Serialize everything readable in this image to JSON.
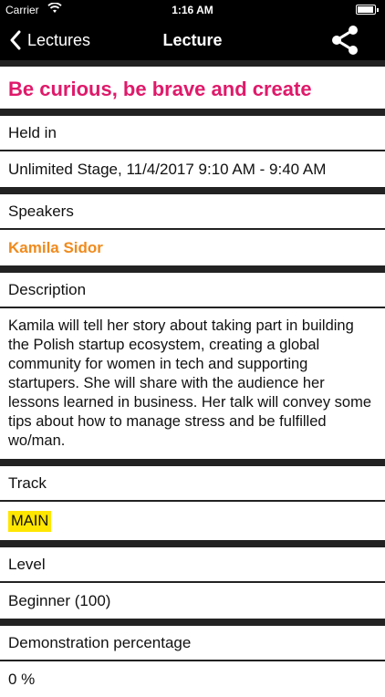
{
  "status_bar": {
    "carrier": "Carrier",
    "time": "1:16 AM",
    "wifi_icon": "wifi-icon",
    "battery_icon": "battery-icon"
  },
  "nav": {
    "back_label": "Lectures",
    "title": "Lecture",
    "back_icon": "chevron-left-icon",
    "share_icon": "share-icon"
  },
  "lecture": {
    "title": "Be curious, be brave and create",
    "held_in_label": "Held in",
    "held_in_value": "Unlimited Stage, 11/4/2017 9:10 AM - 9:40 AM",
    "speakers_label": "Speakers",
    "speaker_name": "Kamila Sidor",
    "description_label": "Description",
    "description_text": "Kamila will tell her story about taking part in building the Polish startup ecosystem, creating a global community for women in tech and supporting startupers. She will share with the audience her lessons learned in business. Her talk will convey some tips about how to manage stress and be fulfilled wo/man.",
    "track_label": "Track",
    "track_value": "MAIN",
    "level_label": "Level",
    "level_value": "Beginner (100)",
    "demo_label": "Demonstration percentage",
    "demo_value": "0 %"
  },
  "colors": {
    "title": "#e0196a",
    "speaker": "#f08a1c",
    "badge": "#ffe600",
    "bars": "#000000"
  }
}
